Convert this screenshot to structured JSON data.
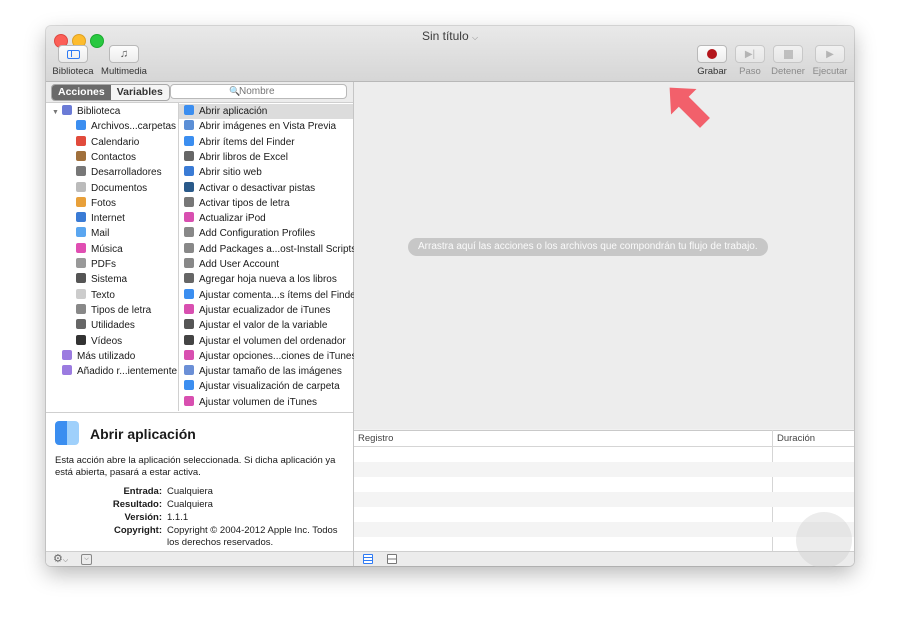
{
  "window": {
    "title": "Sin título"
  },
  "toolbar": {
    "biblioteca": "Biblioteca",
    "multimedia": "Multimedia",
    "grabar": "Grabar",
    "paso": "Paso",
    "detener": "Detener",
    "ejecutar": "Ejecutar"
  },
  "tabs": {
    "acciones": "Acciones",
    "variables": "Variables"
  },
  "search": {
    "placeholder": "Nombre"
  },
  "categories": [
    {
      "label": "Biblioteca",
      "icon": "library-icon"
    },
    {
      "label": "Archivos...carpetas",
      "icon": "finder-icon"
    },
    {
      "label": "Calendario",
      "icon": "calendar-icon"
    },
    {
      "label": "Contactos",
      "icon": "contacts-icon"
    },
    {
      "label": "Desarrolladores",
      "icon": "developer-tools-icon"
    },
    {
      "label": "Documentos",
      "icon": "documents-icon"
    },
    {
      "label": "Fotos",
      "icon": "photos-icon"
    },
    {
      "label": "Internet",
      "icon": "globe-icon"
    },
    {
      "label": "Mail",
      "icon": "mail-icon"
    },
    {
      "label": "Música",
      "icon": "music-icon"
    },
    {
      "label": "PDFs",
      "icon": "pdf-icon"
    },
    {
      "label": "Sistema",
      "icon": "system-icon"
    },
    {
      "label": "Texto",
      "icon": "text-icon"
    },
    {
      "label": "Tipos de letra",
      "icon": "fonts-icon"
    },
    {
      "label": "Utilidades",
      "icon": "utilities-icon"
    },
    {
      "label": "Vídeos",
      "icon": "video-icon"
    },
    {
      "label": "Más utilizado",
      "icon": "smart-folder-icon"
    },
    {
      "label": "Añadido r...ientemente",
      "icon": "smart-folder-icon"
    }
  ],
  "actions": [
    "Abrir aplicación",
    "Abrir imágenes en Vista Previa",
    "Abrir ítems del Finder",
    "Abrir libros de Excel",
    "Abrir sitio web",
    "Activar o desactivar pistas",
    "Activar tipos de letra",
    "Actualizar iPod",
    "Add Configuration Profiles",
    "Add Packages a...ost-Install Scripts",
    "Add User Account",
    "Agregar hoja nueva a los libros",
    "Ajustar comenta...s ítems del Finder",
    "Ajustar ecualizador de iTunes",
    "Ajustar el valor de la variable",
    "Ajustar el volumen del ordenador",
    "Ajustar opciones...ciones de iTunes",
    "Ajustar tamaño de las imágenes",
    "Ajustar visualización de carpeta",
    "Ajustar volumen de iTunes"
  ],
  "description": {
    "title": "Abrir aplicación",
    "text": "Esta acción abre la aplicación seleccionada. Si dicha aplicación ya está abierta, pasará a estar activa.",
    "entrada_label": "Entrada:",
    "entrada": "Cualquiera",
    "resultado_label": "Resultado:",
    "resultado": "Cualquiera",
    "version_label": "Versión:",
    "version": "1.1.1",
    "copyright_label": "Copyright:",
    "copyright": "Copyright © 2004-2012 Apple Inc. Todos los derechos reservados."
  },
  "workflow": {
    "hint": "Arrastra aquí las acciones o los archivos que compondrán tu flujo de trabajo."
  },
  "log": {
    "col_registro": "Registro",
    "col_duracion": "Duración"
  },
  "colors": {
    "accent_arrow": "#f2606b",
    "record": "#b4151b"
  }
}
